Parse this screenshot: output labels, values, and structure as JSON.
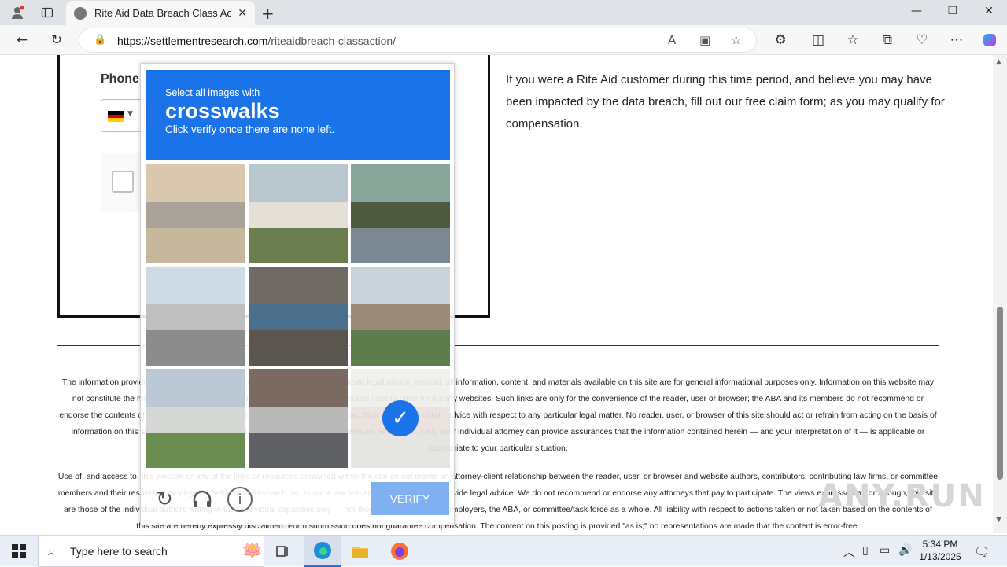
{
  "browser": {
    "tab_title": "Rite Aid Data Breach Class Action",
    "url_domain": "https://settlementresearch.com",
    "url_path": "/riteaidbreach-classaction/"
  },
  "form": {
    "phone_label": "Phone"
  },
  "content": {
    "right_paragraph": "If you were a Rite Aid customer during this time period, and believe you may have been impacted by the data breach, fill out our free claim form; as you may qualify for compensation.",
    "legal_1": "The information provided on this website does not, and is not intended to, constitute legal advice; instead, all information, content, and materials available on this site are for general informational purposes only. Information on this website may not constitute the most up-to-date legal or other information. This website contains links to other third-party websites. Such links are only for the convenience of the reader, user or browser; the ABA and its members do not recommend or endorse the contents of the third-party sites. Readers of this website should contact their attorney to obtain advice with respect to any particular legal matter. No reader, user, or browser of this site should act or refrain from acting on the basis of information on this site without first seeking legal advice from counsel in the relevant jurisdiction. Only your individual attorney can provide assurances that the information contained herein — and your interpretation of it — is applicable or appropriate to your particular situation.",
    "legal_2": "Use of, and access to, this website or any of the links or resources contained within the site do not create an attorney-client relationship between the reader, user, or browser and website authors, contributors, contributing law firms, or committee members and their respective employers. Settlement Research Inc. is not a law firm and does not directly provide legal advice. We do not recommend or endorse any attorneys that pay to participate. The views expressed at, or through, this site are those of the individual authors writing in their individual capacities only — not those of their respective employers, the ABA, or committee/task force as a whole. All liability with respect to actions taken or not taken based on the contents of this site are hereby expressly disclaimed. Form submission does not guarantee compensation. The content on this posting is provided \"as is;\" no representations are made that the content is error-free."
  },
  "captcha": {
    "prompt_line1": "Select all images with",
    "target": "crosswalks",
    "prompt_line2": "Click verify once there are none left.",
    "verify_label": "VERIFY",
    "tiles": [
      {
        "scene": "road-shadow",
        "selected": false
      },
      {
        "scene": "houses",
        "selected": false
      },
      {
        "scene": "traffic",
        "selected": false
      },
      {
        "scene": "bus-intersection",
        "selected": false
      },
      {
        "scene": "motorbike",
        "selected": false
      },
      {
        "scene": "tower",
        "selected": false
      },
      {
        "scene": "parking-lot",
        "selected": false
      },
      {
        "scene": "bus-street",
        "selected": false
      },
      {
        "scene": "street-corner",
        "selected": true
      }
    ]
  },
  "watermark": "ANY.RUN",
  "taskbar": {
    "search_placeholder": "Type here to search",
    "time": "5:34 PM",
    "date": "1/13/2025"
  },
  "colors": {
    "captcha_blue": "#1a73e8",
    "verify_disabled": "#7fb0f2",
    "flag_black": "#000000",
    "flag_red": "#dd0000",
    "flag_gold": "#ffce00"
  }
}
